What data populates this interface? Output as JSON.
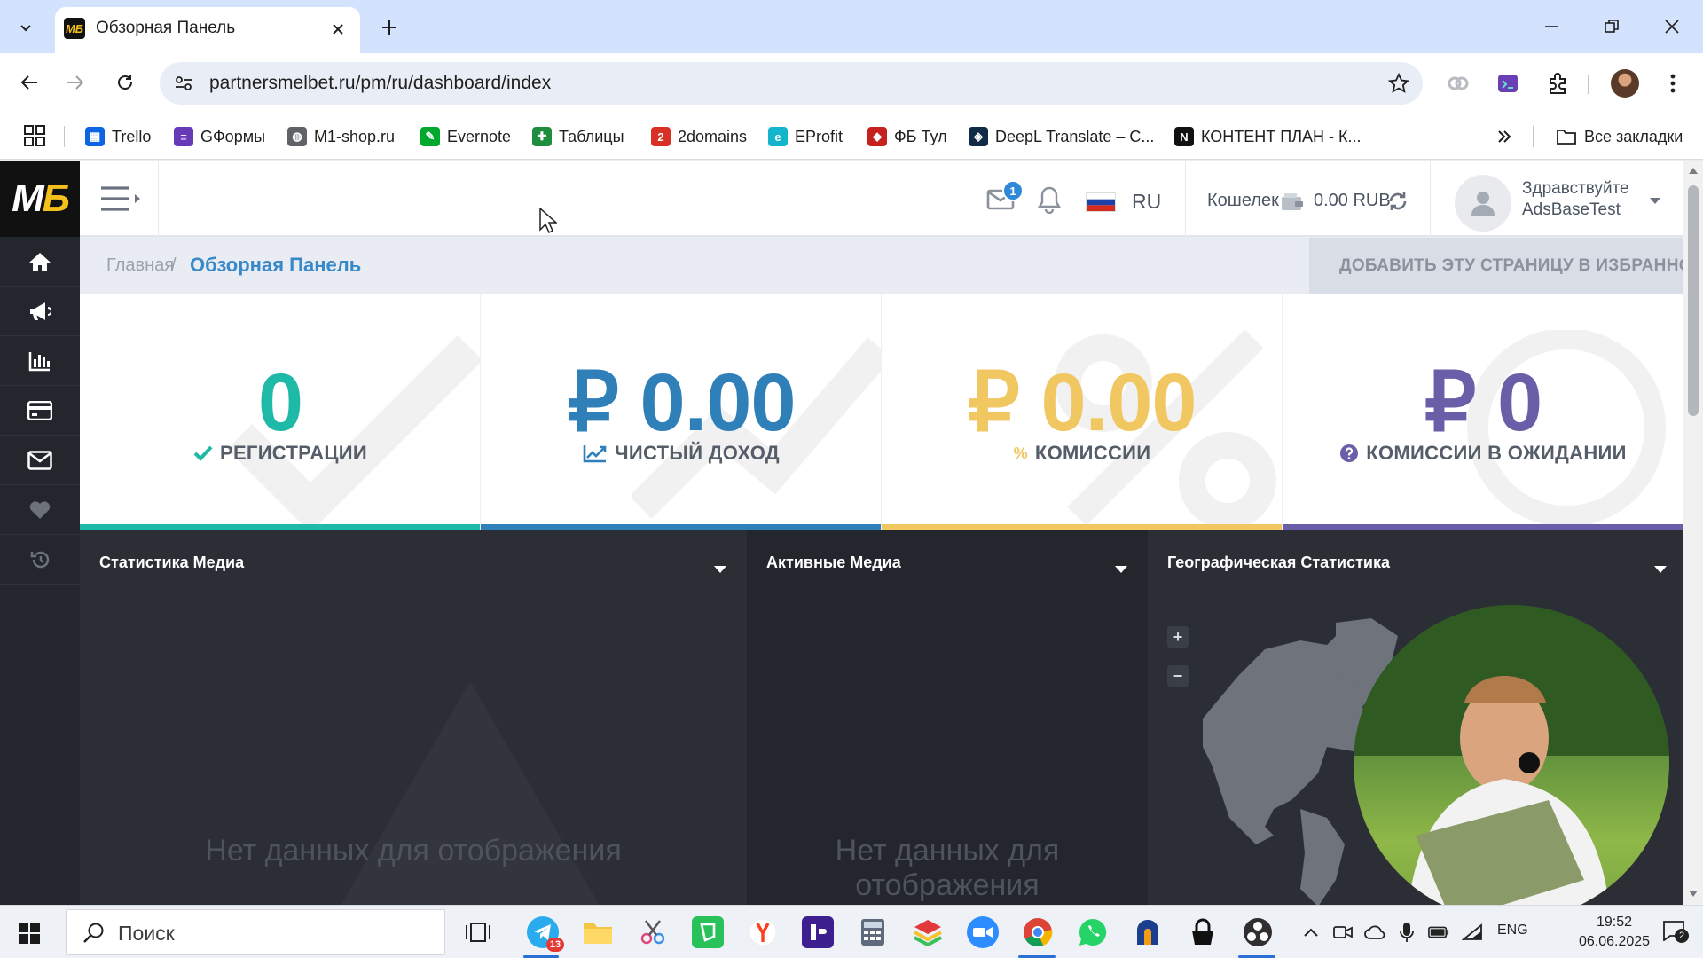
{
  "browser": {
    "tab_title": "Обзорная Панель",
    "url": "partnersmelbet.ru/pm/ru/dashboard/index",
    "bookmarks": [
      {
        "label": "Trello",
        "icon": "trello-icon",
        "color": "#0c66e4"
      },
      {
        "label": "GФормы",
        "icon": "forms-icon",
        "color": "#673ab7"
      },
      {
        "label": "M1-shop.ru",
        "icon": "globe-icon",
        "color": "#5f6368"
      },
      {
        "label": "Evernote",
        "icon": "evernote-icon",
        "color": "#00a82d"
      },
      {
        "label": "Таблицы",
        "icon": "sheets-icon",
        "color": "#1e8e3e"
      },
      {
        "label": "2domains",
        "icon": "2domains-icon",
        "color": "#d93025"
      },
      {
        "label": "EProfit",
        "icon": "eprofit-icon",
        "color": "#12b5cb"
      },
      {
        "label": "ФБ Тул",
        "icon": "fbtool-icon",
        "color": "#c5221f"
      },
      {
        "label": "DeepL Translate – C...",
        "icon": "deepl-icon",
        "color": "#0f2b46"
      },
      {
        "label": "КОНТЕНТ ПЛАН - К...",
        "icon": "notion-icon",
        "color": "#111111"
      }
    ],
    "all_bookmarks_label": "Все закладки"
  },
  "header": {
    "mail_badge": "1",
    "language": "RU",
    "wallet_label": "Кошелек",
    "wallet_amount": "0.00 RUB",
    "greeting_line1": "Здравствуйте",
    "greeting_line2": "AdsBaseTest"
  },
  "breadcrumb": {
    "home": "Главная",
    "separator": "/",
    "current": "Обзорная Панель",
    "favorite_button": "ДОБАВИТЬ ЭТУ СТРАНИЦУ В ИЗБРАННОЕ"
  },
  "stats": [
    {
      "value": "0",
      "label": "РЕГИСТРАЦИИ",
      "icon": "check-icon",
      "color": "#1fb9a8"
    },
    {
      "value": "₽ 0.00",
      "label": "ЧИСТЫЙ ДОХОД",
      "icon": "line-chart-icon",
      "color": "#2f7fb9"
    },
    {
      "value": "₽ 0.00",
      "label": "КОМИССИИ",
      "icon": "percent-icon",
      "prefix": "%",
      "color": "#f1c761"
    },
    {
      "value": "₽ 0",
      "label": "КОМИССИИ В ОЖИДАНИИ",
      "icon": "question-icon",
      "color": "#6b5ea8"
    }
  ],
  "panels": [
    {
      "title": "Статистика Медиа",
      "empty": "Нет данных для отображения"
    },
    {
      "title": "Активные Медиа",
      "empty": "Нет данных для отображения"
    },
    {
      "title": "Географическая Статистика"
    }
  ],
  "map_controls": {
    "zoom_in": "+",
    "zoom_out": "−"
  },
  "taskbar": {
    "search_placeholder": "Поиск",
    "telegram_badge": "13",
    "lang": "ENG",
    "time": "19:52",
    "date": "06.06.2025",
    "notification_count": "2"
  }
}
